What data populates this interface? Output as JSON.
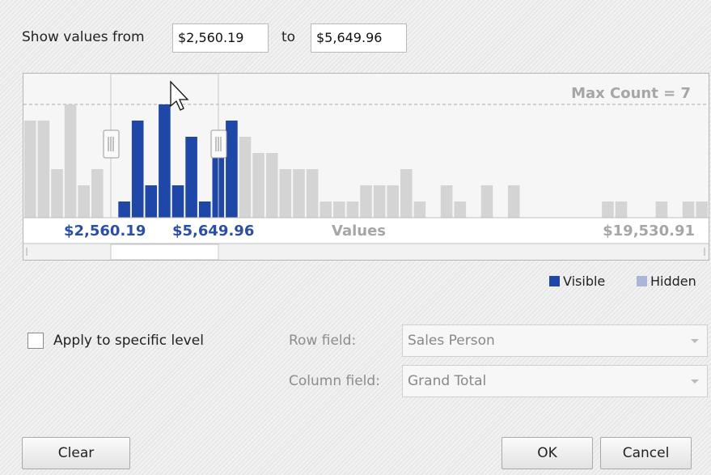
{
  "filter": {
    "show_values_from_label": "Show values from",
    "from_value": "$2,560.19",
    "to_label": "to",
    "to_value": "$5,649.96"
  },
  "histogram": {
    "max_count_label": "Max Count = 7",
    "max_count": 7,
    "min_selected": "$2,560.19",
    "max_selected": "$5,649.96",
    "axis_label": "Values",
    "max_value": "$19,530.91",
    "visible_color": "#1f47a8",
    "hidden_color": "#d4d4d4",
    "bar_counts": [
      6,
      6,
      3,
      7,
      2,
      3,
      0,
      1,
      6,
      2,
      7,
      2,
      5,
      1,
      5,
      6,
      5,
      4,
      4,
      3,
      3,
      3,
      1,
      1,
      1,
      2,
      2,
      2,
      3,
      1,
      0,
      2,
      1,
      0,
      2,
      0,
      2,
      0,
      0,
      0,
      0,
      0,
      0,
      1,
      1,
      0,
      0,
      1,
      0,
      1,
      1
    ],
    "visible_bar_indices": [
      7,
      8,
      9,
      10,
      11,
      12,
      13,
      14,
      15
    ]
  },
  "legend": {
    "visible_label": "Visible",
    "hidden_label": "Hidden",
    "visible_color": "#1f47a8",
    "hidden_color": "#aab6d6"
  },
  "options": {
    "apply_label": "Apply to specific level",
    "apply_checked": false,
    "row_field_label": "Row field:",
    "row_field_value": "Sales Person",
    "column_field_label": "Column field:",
    "column_field_value": "Grand Total"
  },
  "buttons": {
    "clear": "Clear",
    "ok": "OK",
    "cancel": "Cancel"
  }
}
